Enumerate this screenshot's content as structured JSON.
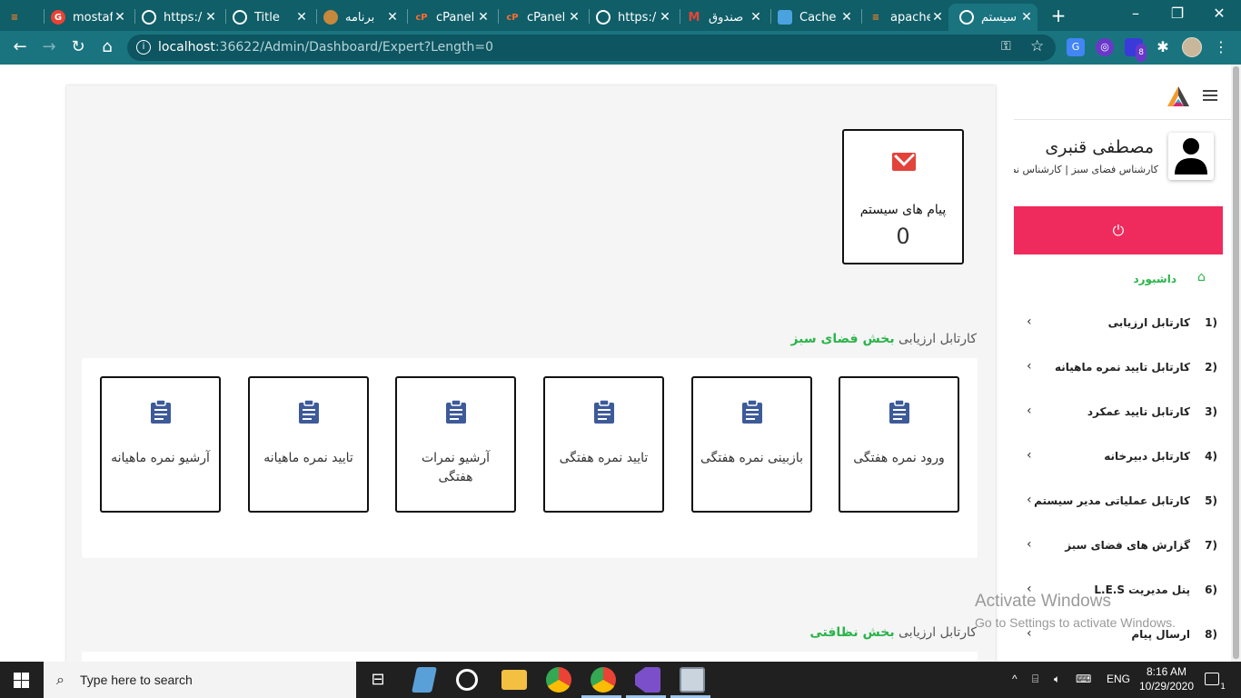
{
  "browser": {
    "tabs": [
      {
        "title": "",
        "favicon": "stackoverflow-icon",
        "color": "#f48024"
      },
      {
        "title": "mostaf",
        "favicon": "g-icon",
        "color": "#e94235"
      },
      {
        "title": "https:/",
        "favicon": "globe-icon",
        "color": "#ffffff"
      },
      {
        "title": "Title",
        "favicon": "globe-icon",
        "color": "#ffffff"
      },
      {
        "title": "برنامه",
        "favicon": "basket-icon",
        "color": "#c5883c"
      },
      {
        "title": "cPanel",
        "favicon": "cpanel-icon",
        "color": "#ff6c2c"
      },
      {
        "title": "cPanel",
        "favicon": "cpanel-icon",
        "color": "#ff6c2c"
      },
      {
        "title": "https:/",
        "favicon": "globe-icon",
        "color": "#ffffff"
      },
      {
        "title": "صندوق",
        "favicon": "gmail-icon",
        "color": "#ea4335"
      },
      {
        "title": "Cache",
        "favicon": "cache-icon",
        "color": "#4aa3df"
      },
      {
        "title": "apache",
        "favicon": "stackoverflow-icon",
        "color": "#f48024"
      },
      {
        "title": "سیستم",
        "favicon": "globe-icon",
        "color": "#ffffff",
        "active": true
      }
    ],
    "address": {
      "host": "localhost",
      "path": ":36622/Admin/Dashboard/Expert?Length=0"
    },
    "extension_badge": "8"
  },
  "page": {
    "system_messages": {
      "label": "پیام های سیستم",
      "count": "0"
    },
    "section1": {
      "prefix": "کارتابل ارزیابی",
      "highlight": "بخش فضای سبز"
    },
    "section2": {
      "prefix": "کارتابل ارزیابی",
      "highlight": "بخش نظافتی"
    },
    "tiles": [
      {
        "label": "ورود نمره هفتگی"
      },
      {
        "label": "بازبینی نمره هفتگی"
      },
      {
        "label": "تایید نمره هفتگی"
      },
      {
        "label": "آرشیو نمرات هفتگی"
      },
      {
        "label": "تایید نمره ماهیانه"
      },
      {
        "label": "آرشیو نمره ماهیانه"
      }
    ]
  },
  "sidebar": {
    "user_name": "مصطفی قنبری",
    "user_role": "کارشناس فضای سبز | کارشناس نظافت",
    "dashboard_label": "داشبورد",
    "menu": [
      {
        "num": "1)",
        "label": "کارتابل ارزیابی"
      },
      {
        "num": "2)",
        "label": "کارتابل تایید نمره ماهیانه"
      },
      {
        "num": "3)",
        "label": "کارتابل تایید عمکرد"
      },
      {
        "num": "4)",
        "label": "کارتابل دبیرخانه"
      },
      {
        "num": "5)",
        "label": "کارتابل عملیاتی مدیر سیستم"
      },
      {
        "num": "7)",
        "label": "گزارش های فضای سبز"
      },
      {
        "num": "6)",
        "label": "پنل مدیریت L.E.S"
      },
      {
        "num": "8)",
        "label": "ارسال پیام"
      }
    ]
  },
  "watermark": {
    "line1": "Activate Windows",
    "line2": "Go to Settings to activate Windows."
  },
  "taskbar": {
    "search_placeholder": "Type here to search",
    "language": "ENG",
    "time": "8:16 AM",
    "date": "10/29/2020",
    "notification_count": "1"
  },
  "colors": {
    "accent_green": "#2bb44a",
    "logout_pink": "#ef2a5d",
    "clipboard_blue": "#3d5a99",
    "chrome_teal": "#1a7480"
  }
}
